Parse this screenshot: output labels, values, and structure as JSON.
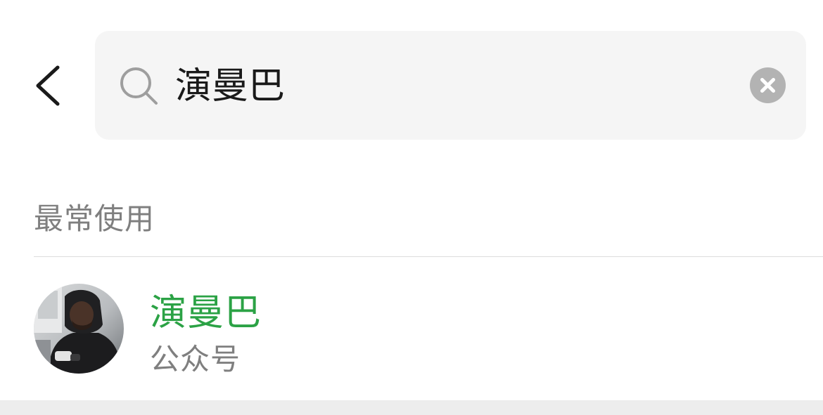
{
  "header": {
    "back_icon": "chevron-left-icon"
  },
  "search": {
    "query": "演曼巴",
    "search_icon": "search-icon",
    "clear_icon": "close-icon"
  },
  "section": {
    "title": "最常使用"
  },
  "results": [
    {
      "title": "演曼巴",
      "subtitle": "公众号",
      "avatar_icon": "avatar"
    }
  ],
  "colors": {
    "accent": "#2ba245",
    "secondary_text": "#7f7f7f",
    "search_bg": "#f5f5f5",
    "clear_button": "#b3b3b3",
    "divider": "#dcdcdc"
  }
}
